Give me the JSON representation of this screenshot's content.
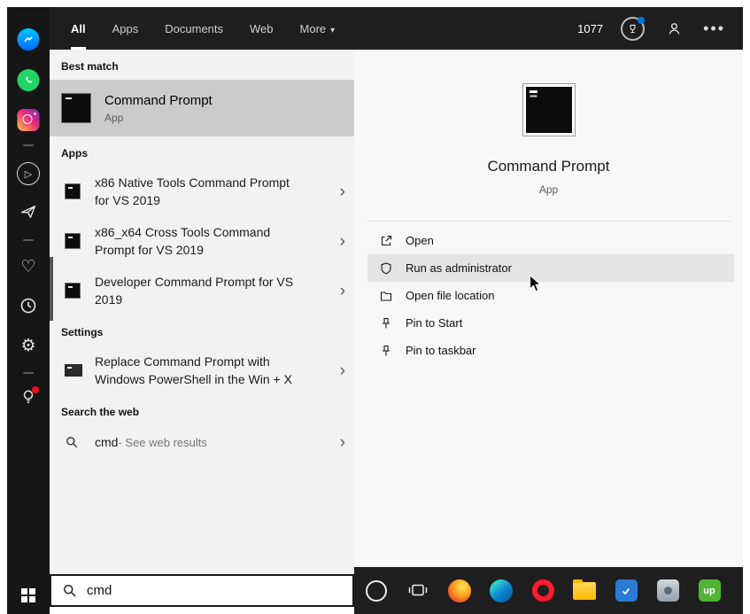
{
  "colors": {
    "accent": "#0078d7",
    "notification_red": "#e81123",
    "selected_row": "#cbcbcb",
    "hover_row": "#e4e4e4"
  },
  "header": {
    "tabs": {
      "all": "All",
      "apps": "Apps",
      "documents": "Documents",
      "web": "Web",
      "more": "More"
    },
    "rewards_count": "1077"
  },
  "results": {
    "best_match_label": "Best match",
    "best_match": {
      "title": "Command Prompt",
      "type": "App"
    },
    "apps_label": "Apps",
    "apps": [
      {
        "title": "x86 Native Tools Command Prompt for VS 2019"
      },
      {
        "title": "x86_x64 Cross Tools Command Prompt for VS 2019"
      },
      {
        "title": "Developer Command Prompt for VS 2019"
      }
    ],
    "settings_label": "Settings",
    "settings": [
      {
        "title": "Replace Command Prompt with Windows PowerShell in the Win + X"
      }
    ],
    "web_label": "Search the web",
    "web_item": {
      "query": "cmd",
      "suffix": " - See web results"
    }
  },
  "preview": {
    "title": "Command Prompt",
    "type": "App",
    "actions": [
      {
        "label": "Open"
      },
      {
        "label": "Run as administrator"
      },
      {
        "label": "Open file location"
      },
      {
        "label": "Pin to Start"
      },
      {
        "label": "Pin to taskbar"
      }
    ]
  },
  "taskbar": {
    "search_value": "cmd",
    "uipath_label": "up"
  }
}
